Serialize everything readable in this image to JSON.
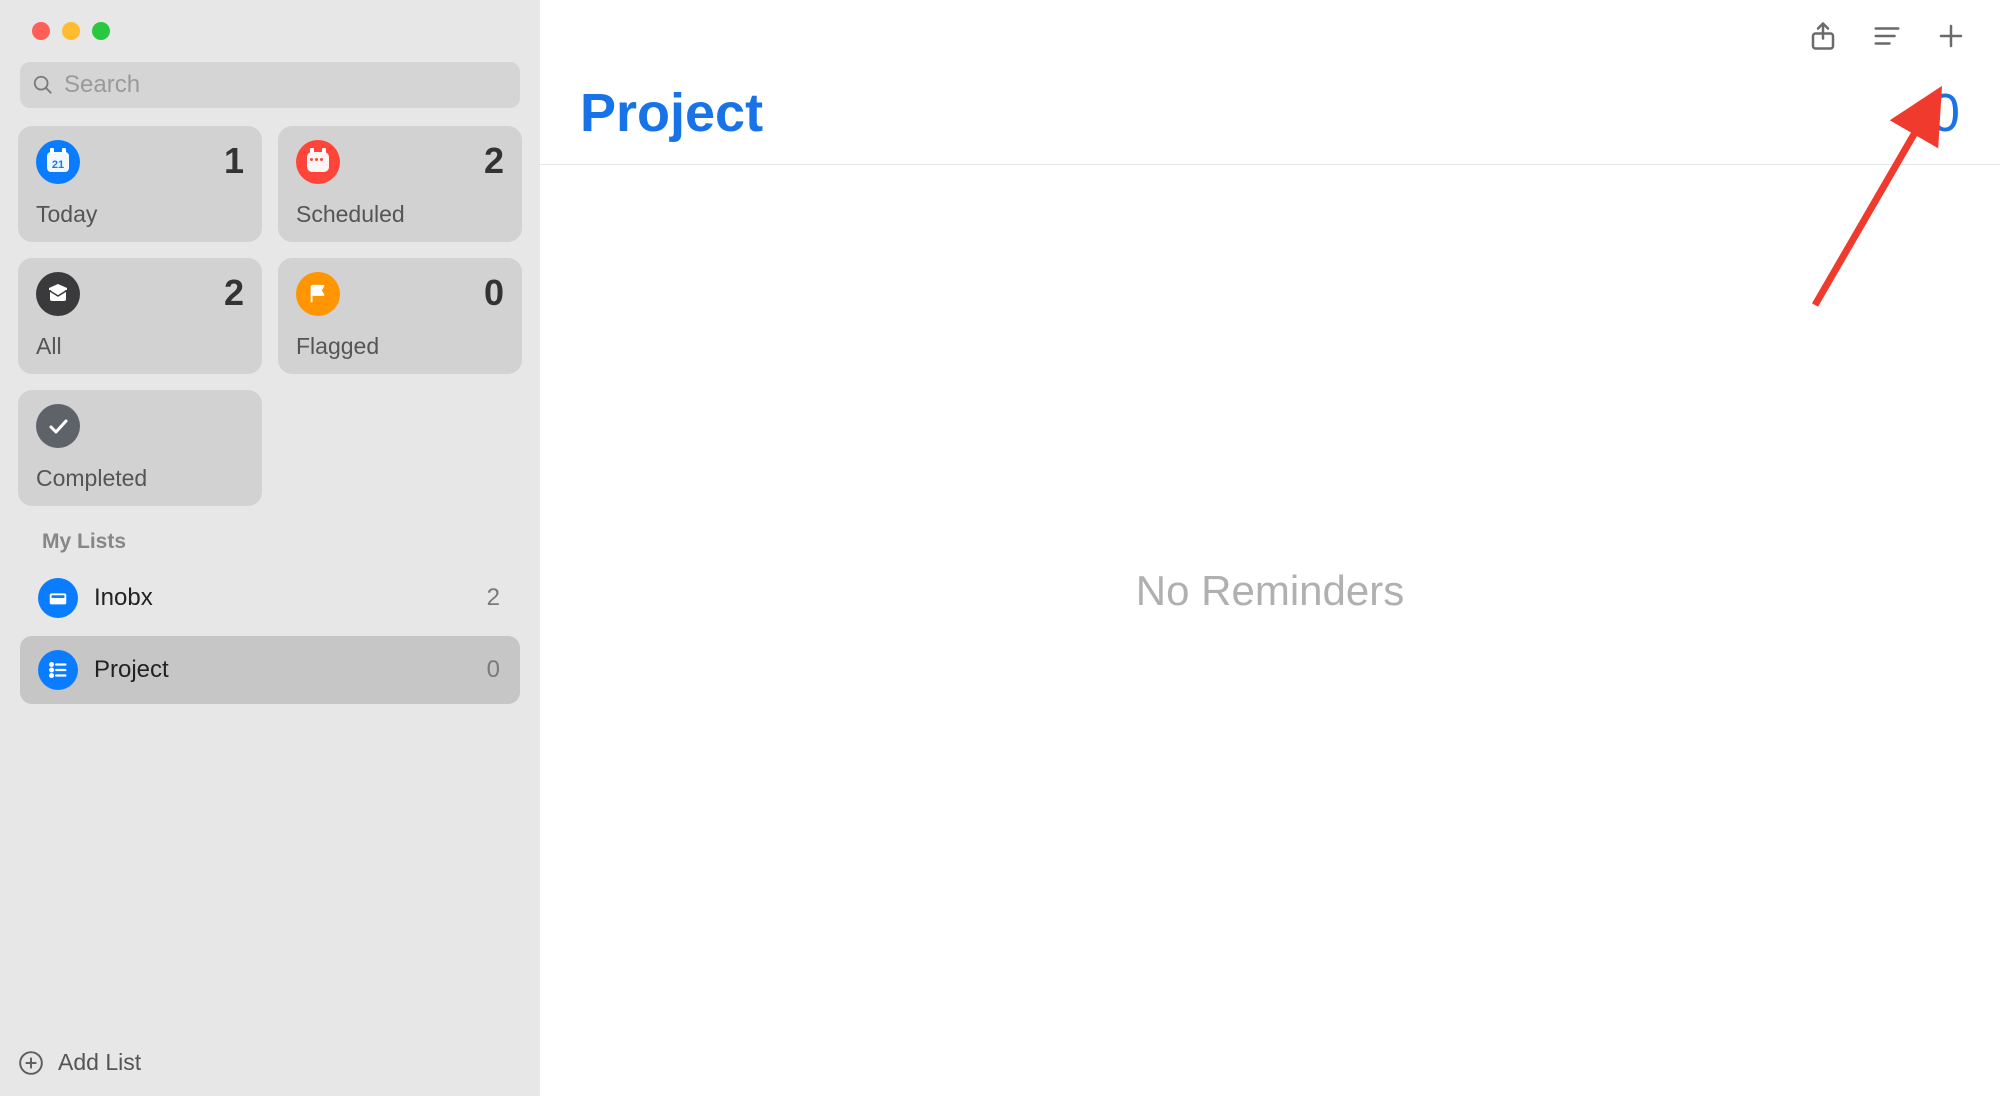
{
  "search": {
    "placeholder": "Search"
  },
  "cards": {
    "today": {
      "label": "Today",
      "count": "1"
    },
    "scheduled": {
      "label": "Scheduled",
      "count": "2"
    },
    "all": {
      "label": "All",
      "count": "2"
    },
    "flagged": {
      "label": "Flagged",
      "count": "0"
    },
    "completed": {
      "label": "Completed"
    }
  },
  "myListsLabel": "My Lists",
  "lists": [
    {
      "name": "Inobx",
      "count": "2"
    },
    {
      "name": "Project",
      "count": "0"
    }
  ],
  "addListLabel": "Add List",
  "main": {
    "title": "Project",
    "count": "0",
    "emptyText": "No Reminders"
  }
}
